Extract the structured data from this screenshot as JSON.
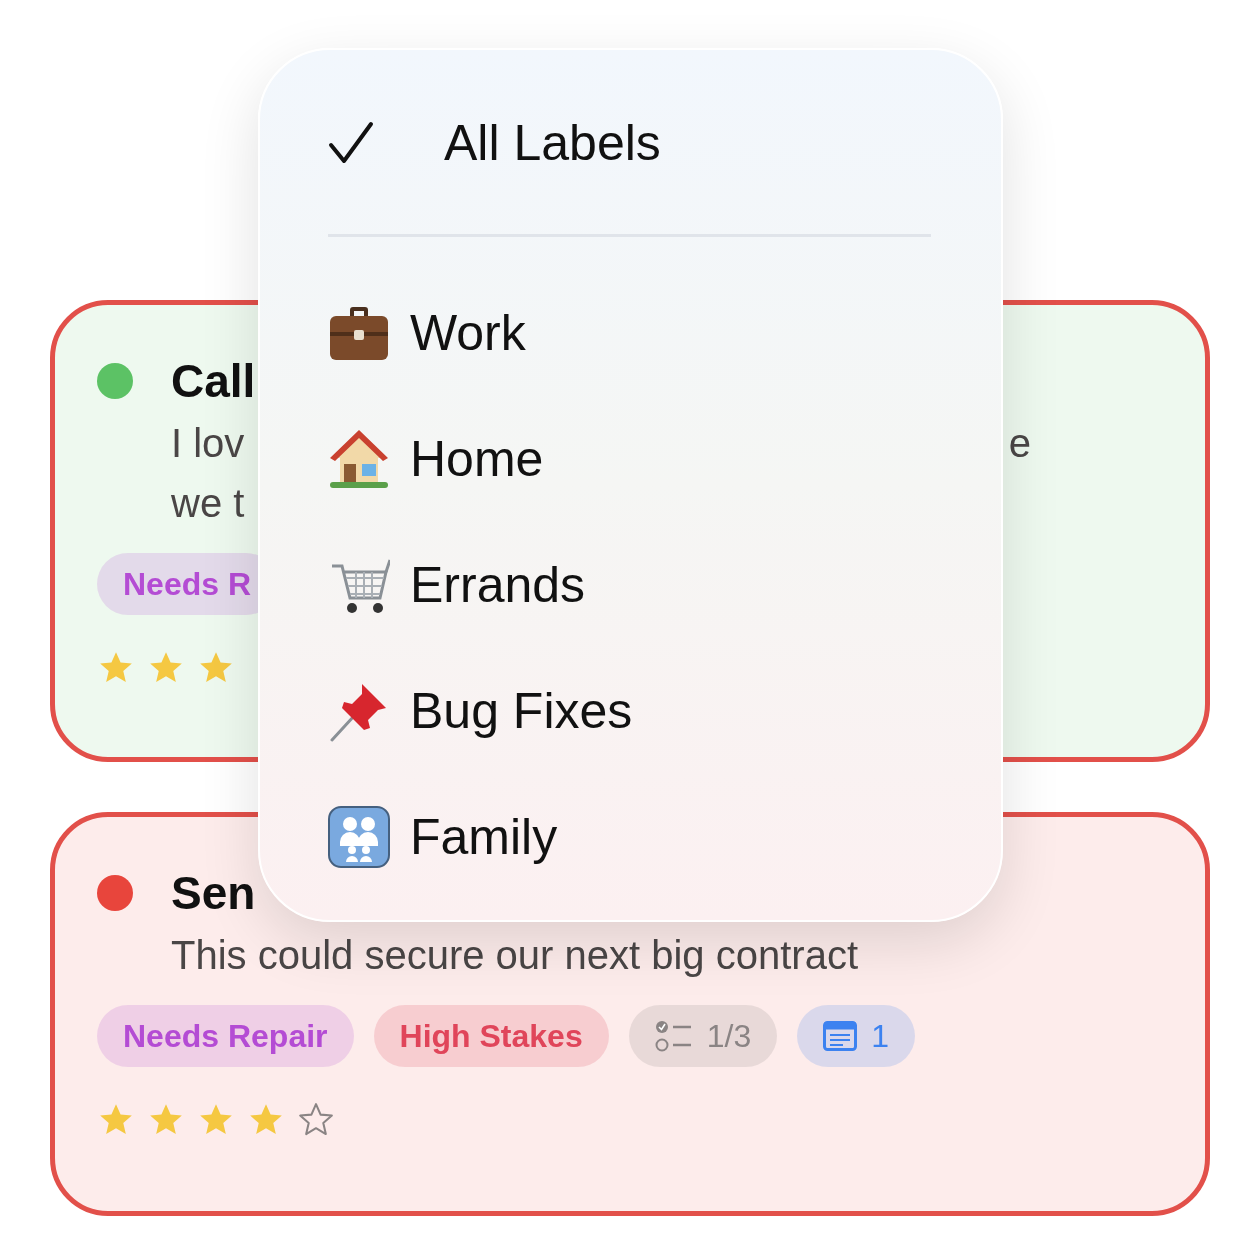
{
  "cards": [
    {
      "color": "#5cc265",
      "title": "Call",
      "description_lines": [
        "I lov",
        "we t"
      ],
      "line_end_fragment": "e",
      "tags": [
        {
          "kind": "label",
          "text": "Needs R",
          "color": "#b44cd4"
        }
      ],
      "stars": 3,
      "clipped": true
    },
    {
      "color": "#e8453c",
      "title": "Sen",
      "description_lines": [
        "This could secure our next big contract"
      ],
      "tags": [
        {
          "kind": "label",
          "text": "Needs Repair",
          "color": "#b44cd4"
        },
        {
          "kind": "label",
          "text": "High Stakes",
          "color": "#e0455a"
        },
        {
          "kind": "checklist",
          "text": "1/3",
          "color": "#8a8484"
        },
        {
          "kind": "note",
          "text": "1",
          "color": "#3c82f0"
        }
      ],
      "stars": 4,
      "clipped": false
    }
  ],
  "menu": {
    "items": [
      {
        "label": "All Labels",
        "selected": true
      },
      {
        "label": "Work",
        "selected": false
      },
      {
        "label": "Home",
        "selected": false
      },
      {
        "label": "Errands",
        "selected": false
      },
      {
        "label": "Bug Fixes",
        "selected": false
      },
      {
        "label": "Family",
        "selected": false
      }
    ]
  }
}
